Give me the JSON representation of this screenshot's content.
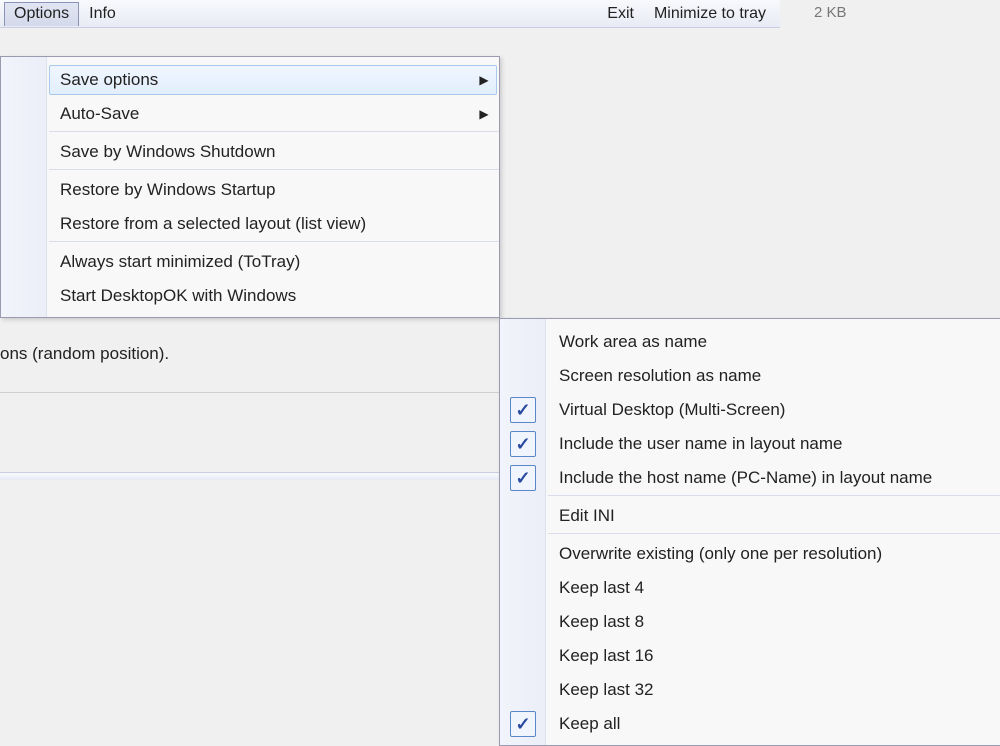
{
  "menubar": {
    "options": "Options",
    "info": "Info",
    "exit": "Exit",
    "minimize": "Minimize to tray"
  },
  "file_size": "2 KB",
  "background_text": "ons (random position).",
  "left_menu": {
    "items": [
      {
        "label": "Save options",
        "hasSubmenu": true,
        "highlighted": true
      },
      {
        "label": "Auto-Save",
        "hasSubmenu": true
      },
      {
        "sep": true
      },
      {
        "label": "Save by Windows Shutdown"
      },
      {
        "sep": true
      },
      {
        "label": "Restore by Windows Startup"
      },
      {
        "label": "Restore from a selected layout (list view)"
      },
      {
        "sep": true
      },
      {
        "label": "Always start minimized (ToTray)"
      },
      {
        "label": "Start DesktopOK with Windows"
      }
    ]
  },
  "right_menu": {
    "items": [
      {
        "label": "Work area as name"
      },
      {
        "label": "Screen resolution as name"
      },
      {
        "label": "Virtual Desktop (Multi-Screen)",
        "checked": true
      },
      {
        "label": "Include the user name in layout name",
        "checked": true
      },
      {
        "label": "Include the host name (PC-Name) in layout name",
        "checked": true
      },
      {
        "sep": true
      },
      {
        "label": "Edit INI"
      },
      {
        "sep": true
      },
      {
        "label": "Overwrite existing (only one per resolution)"
      },
      {
        "label": "Keep last 4"
      },
      {
        "label": "Keep last 8"
      },
      {
        "label": "Keep last 16"
      },
      {
        "label": "Keep last 32"
      },
      {
        "label": "Keep all",
        "checked": true
      }
    ]
  }
}
